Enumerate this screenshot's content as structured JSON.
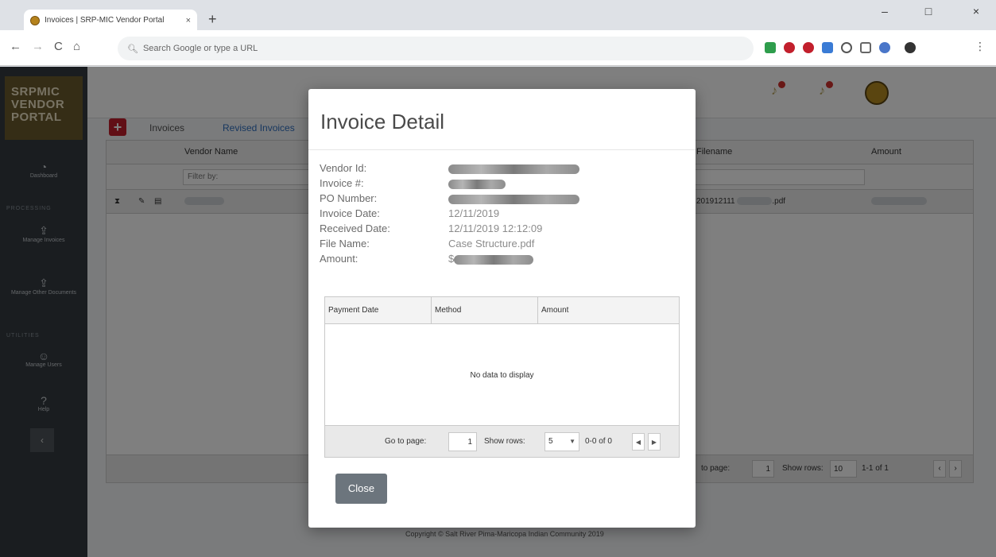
{
  "browser": {
    "tab_title": "Invoices | SRP-MIC Vendor Portal",
    "tab_close": "×",
    "new_tab": "+",
    "back": "←",
    "forward": "→",
    "reload": "C",
    "home": "⌂",
    "omnibox_placeholder": "Search Google or type a URL",
    "win_min": "–",
    "win_max": "□",
    "win_close": "×",
    "ext_colors": [
      "#2e9d4c",
      "#c21f2c",
      "#c21f2c",
      "#3a7bd5",
      "#555555",
      "#666666",
      "#4a76c9"
    ]
  },
  "app": {
    "logo_lines": [
      "SRPMIC",
      "VENDOR",
      "PORTAL"
    ],
    "sidebar": {
      "dashboard": "Dashboard",
      "section_processing": "PROCESSING",
      "manage_invoices": "Manage Invoices",
      "manage_other_docs": "Manage Other Documents",
      "section_utilities": "UTILITIES",
      "manage_users": "Manage Users",
      "help": "Help",
      "collapse": "‹"
    },
    "tabs": [
      "Invoices",
      "Revised Invoices"
    ],
    "grid": {
      "col_vendor_name": "Vendor Name",
      "col_filename": "Filename",
      "col_amount": "Amount",
      "filter_placeholder": "Filter by:",
      "row_filename": "201912111",
      "row_ext": ".pdf"
    },
    "pager": {
      "go_to_page": "to page:",
      "page": "1",
      "show_rows": "Show rows:",
      "rows": "10",
      "range": "1-1 of 1"
    },
    "copyright": "Copyright © Salt River Pima-Maricopa Indian Community 2019"
  },
  "modal": {
    "title": "Invoice Detail",
    "fields": [
      {
        "label": "Vendor Id:",
        "value": ""
      },
      {
        "label": "Invoice #:",
        "value": ""
      },
      {
        "label": "PO Number:",
        "value": ""
      },
      {
        "label": "Invoice Date:",
        "value": "12/11/2019"
      },
      {
        "label": "Received Date:",
        "value": "12/11/2019 12:12:09"
      },
      {
        "label": "File Name:",
        "value": "Case Structure.pdf"
      },
      {
        "label": "Amount:",
        "value": "$"
      }
    ],
    "payments": {
      "columns": [
        "Payment Date",
        "Method",
        "Amount"
      ],
      "empty_text": "No data to display",
      "go_to_page_label": "Go to page:",
      "page": "1",
      "show_rows_label": "Show rows:",
      "rows": "5",
      "range": "0-0 of 0"
    },
    "close_label": "Close"
  }
}
